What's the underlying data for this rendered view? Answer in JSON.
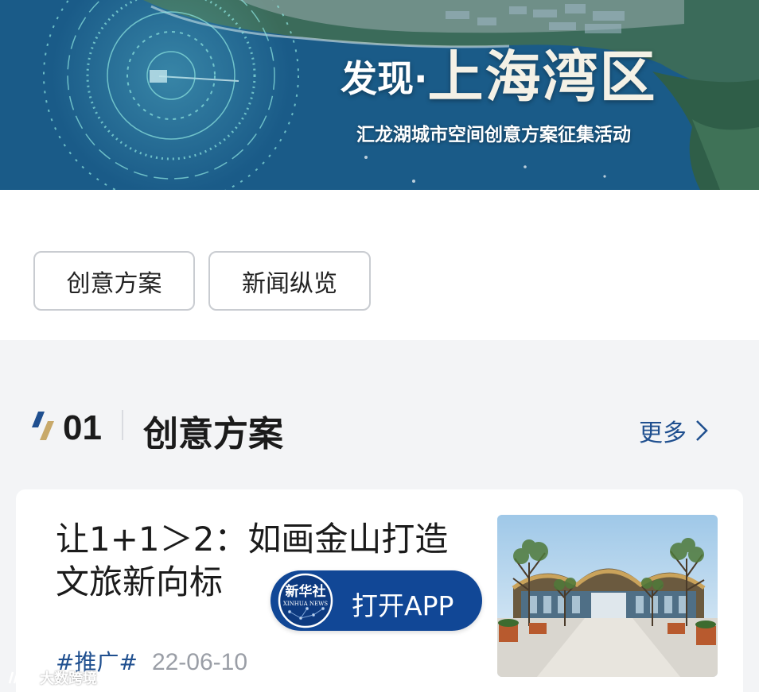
{
  "banner": {
    "title_prefix": "发现·",
    "title_main": "上海湾区",
    "subtitle": "汇龙湖城市空间创意方案征集活动"
  },
  "tabs": [
    {
      "label": "创意方案"
    },
    {
      "label": "新闻纵览"
    }
  ],
  "section": {
    "number": "01",
    "title": "创意方案",
    "more_label": "更多"
  },
  "card": {
    "title": "让1+1＞2：如画金山打造文旅新向标",
    "tag": "#推广#",
    "date": "22-06-10"
  },
  "app_banner": {
    "logo_text": "新华社",
    "logo_subtext": "XINHUA NEWS",
    "button_label": "打开APP"
  },
  "watermark": {
    "text": "大数跨境"
  },
  "colors": {
    "accent_blue": "#1f4f8f",
    "app_blue": "#114796",
    "section_bg": "#f3f4f6",
    "gold": "#c8a96a"
  },
  "icons": [
    "chevron-right-icon",
    "section-mark-icon",
    "xinhua-logo-icon"
  ]
}
